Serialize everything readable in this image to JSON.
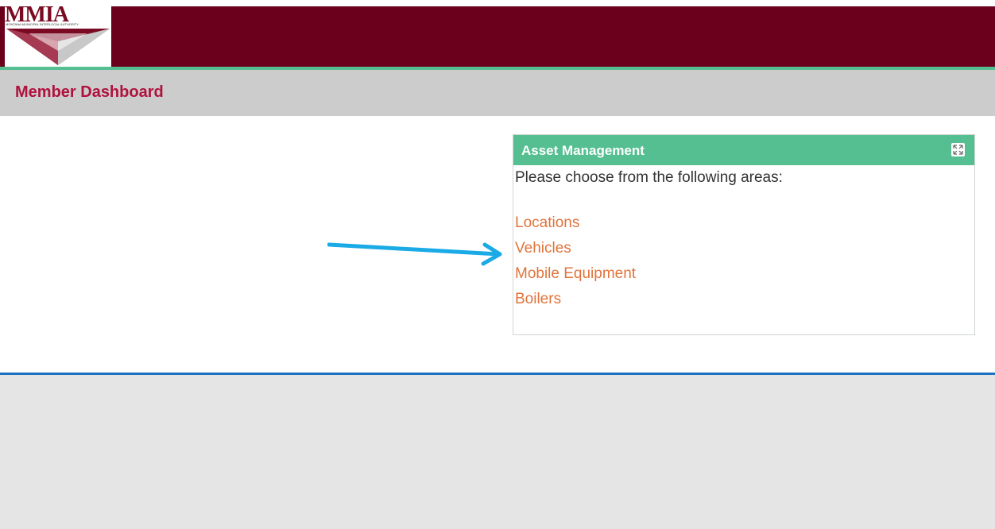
{
  "header": {
    "logo_text": "MMIA",
    "logo_subtext": "MONTANA MUNICIPAL INTERLOCAL AUTHORITY",
    "brand_color": "#6a001c",
    "accent_color": "#55bf91"
  },
  "subheader": {
    "page_title": "Member Dashboard"
  },
  "widget": {
    "title": "Asset Management",
    "intro": "Please choose from the following areas:",
    "expand_icon": "expand-icon",
    "links": [
      {
        "label": "Locations"
      },
      {
        "label": "Vehicles"
      },
      {
        "label": "Mobile Equipment"
      },
      {
        "label": "Boilers"
      }
    ],
    "link_color": "#e0743b"
  },
  "annotation": {
    "arrow_icon": "arrow-right-icon",
    "arrow_color": "#1aaae6"
  }
}
